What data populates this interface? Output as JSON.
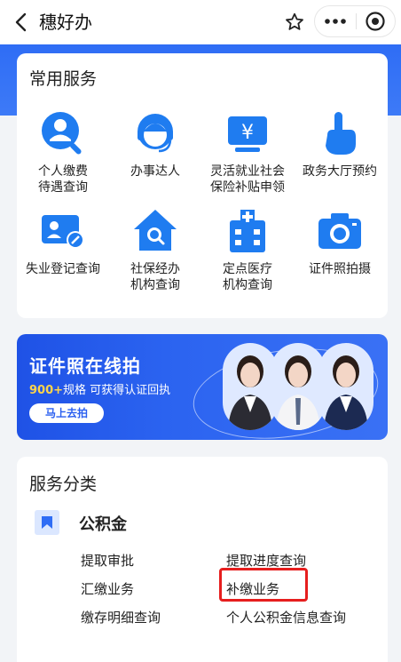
{
  "header": {
    "title": "穗好办",
    "back_icon": "chevron-left-icon",
    "favorite_icon": "star-outline-icon",
    "more_icon": "more-dots-icon",
    "close_icon": "target-circle-icon"
  },
  "colors": {
    "primary_blue": "#2f6df5",
    "icon_blue": "#1f7cf0",
    "highlight_red": "#e61e1e",
    "badge_yellow": "#ffd54a"
  },
  "common_services": {
    "title": "常用服务",
    "items": [
      {
        "label": "个人缴费\n待遇查询",
        "icon": "person-search-icon"
      },
      {
        "label": "办事达人",
        "icon": "customer-service-icon"
      },
      {
        "label": "灵活就业社会\n保险补贴申领",
        "icon": "yen-card-icon"
      },
      {
        "label": "政务大厅预约",
        "icon": "pointing-hand-icon"
      },
      {
        "label": "失业登记查询",
        "icon": "id-card-edit-icon"
      },
      {
        "label": "社保经办\n机构查询",
        "icon": "house-search-icon"
      },
      {
        "label": "定点医疗\n机构查询",
        "icon": "hospital-icon"
      },
      {
        "label": "证件照拍摄",
        "icon": "camera-icon"
      }
    ]
  },
  "promo": {
    "title": "证件照在线拍",
    "sub_highlight": "900+",
    "sub_text": "规格 可获得认证回执",
    "button": "马上去拍"
  },
  "service_category": {
    "title": "服务分类",
    "group_name": "公积金",
    "group_icon": "bookmark-icon",
    "links": [
      {
        "label": "提取审批"
      },
      {
        "label": "提取进度查询"
      },
      {
        "label": "汇缴业务"
      },
      {
        "label": "补缴业务",
        "highlighted": true
      },
      {
        "label": "缴存明细查询"
      },
      {
        "label": "个人公积金信息查询"
      }
    ]
  }
}
